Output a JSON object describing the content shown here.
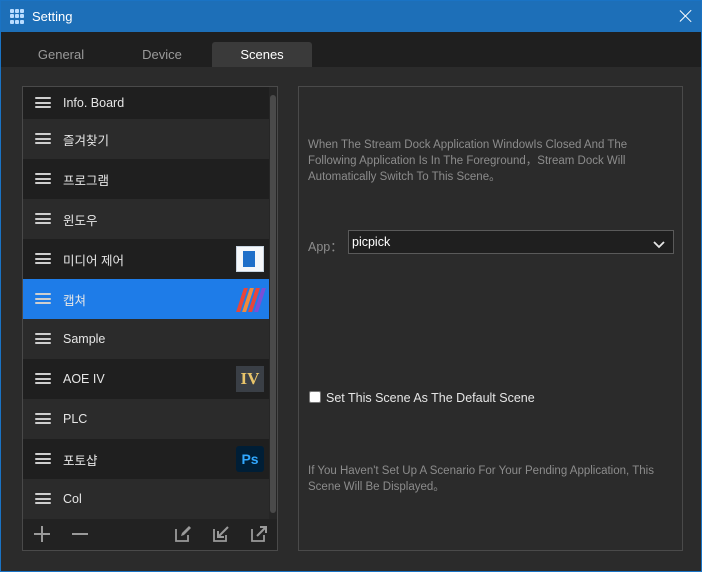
{
  "window": {
    "title": "Setting"
  },
  "tabs": [
    {
      "label": "General",
      "active": false
    },
    {
      "label": "Device",
      "active": false
    },
    {
      "label": "Scenes",
      "active": true
    }
  ],
  "scenes": [
    {
      "label": "Info. Board",
      "thumbnail": null
    },
    {
      "label": "즐겨찾기",
      "thumbnail": null
    },
    {
      "label": "프로그램",
      "thumbnail": null
    },
    {
      "label": "윈도우",
      "thumbnail": null
    },
    {
      "label": "미디어 제어",
      "thumbnail": "media-app-icon"
    },
    {
      "label": "캡쳐",
      "thumbnail": "picpick-app-icon",
      "selected": true
    },
    {
      "label": "Sample",
      "thumbnail": null
    },
    {
      "label": "AOE IV",
      "thumbnail": "aoe4-app-icon",
      "thumbnail_text": "IV"
    },
    {
      "label": "PLC",
      "thumbnail": null
    },
    {
      "label": "포토샵",
      "thumbnail": "photoshop-app-icon",
      "thumbnail_text": "Ps"
    },
    {
      "label": "Col",
      "thumbnail": null
    }
  ],
  "scene_toolbar": {
    "icons": [
      "plus-icon",
      "minus-icon",
      "edit-icon",
      "import-icon",
      "export-icon"
    ]
  },
  "scene_detail": {
    "description": "When The Stream Dock Application WindowIs Closed And The Following Application Is In The Foreground，Stream Dock Will Automatically Switch To This Scene。",
    "app_label": "App：",
    "app_value": "picpick",
    "default_checkbox_label": "Set This Scene As The Default Scene",
    "default_checked": false,
    "footer_note": "If You Haven't Set Up A Scenario For Your Pending Application, This Scene Will Be Displayed。"
  },
  "colors": {
    "title_bar": "#1d6fb8",
    "selected_row": "#1e7ce8",
    "background": "#2b2b2b"
  }
}
